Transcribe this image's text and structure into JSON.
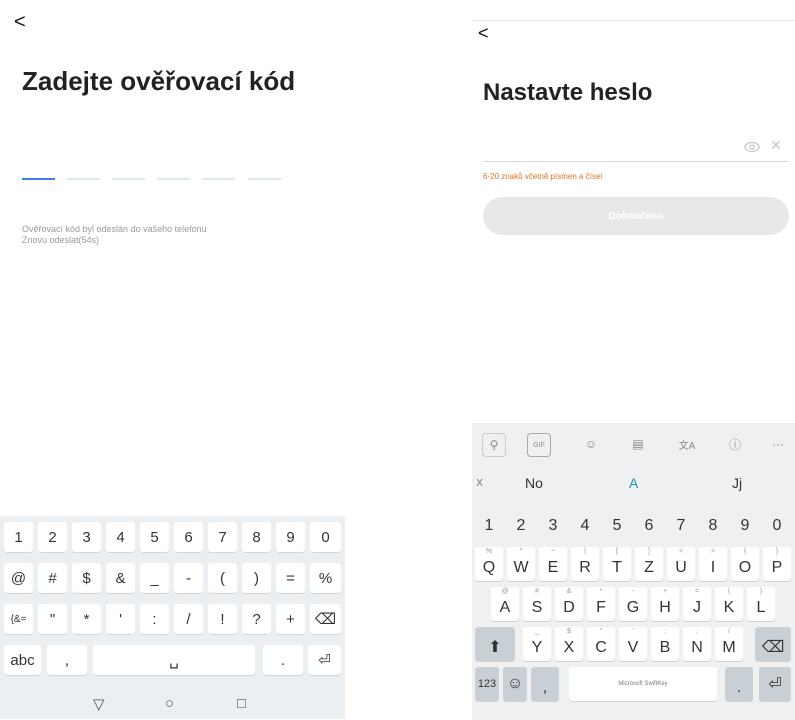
{
  "left": {
    "back_glyph": "<",
    "title": "Zadejte ověřovací kód",
    "code_slots": 6,
    "hint": "Ověřovací kód byl odeslán do vašeho telefonu",
    "resend": "Znovu odeslat(54s)",
    "keyboard": {
      "row1": [
        "1",
        "2",
        "3",
        "4",
        "5",
        "6",
        "7",
        "8",
        "9",
        "0"
      ],
      "row2": [
        "@",
        "#",
        "$",
        "&",
        "_",
        "-",
        "(",
        ")",
        "=",
        "%"
      ],
      "row3": [
        "{&=",
        "\"",
        "*",
        "'",
        ":",
        "/",
        "!",
        "?",
        "+",
        "⌫"
      ],
      "row4": {
        "abc": "abc",
        "comma": ",",
        "space": "␣",
        "dot": ".",
        "enter": "⏎"
      }
    },
    "nav": {
      "back": "▽",
      "home": "○",
      "recent": "□"
    }
  },
  "right": {
    "back_glyph": "<",
    "title": "Nastavte heslo",
    "password_value": "",
    "hint": "6-20 znaků včetně písmen a čísel",
    "done_label": "Dokončeno",
    "toolbar": {
      "search": "🔍",
      "gif": "GIF",
      "sticker": "☺",
      "clipboard": "📋",
      "translate": "文A",
      "info": "ⓘ",
      "more": "···"
    },
    "suggestions": [
      "No",
      "A",
      "Jj"
    ],
    "collapse_glyph": "⌄",
    "keyboard": {
      "numbers": [
        "1",
        "2",
        "3",
        "4",
        "5",
        "6",
        "7",
        "8",
        "9",
        "0"
      ],
      "row1": [
        {
          "k": "Q",
          "h": "%"
        },
        {
          "k": "W",
          "h": "^"
        },
        {
          "k": "E",
          "h": "~"
        },
        {
          "k": "R",
          "h": "|"
        },
        {
          "k": "T",
          "h": "["
        },
        {
          "k": "Z",
          "h": "]"
        },
        {
          "k": "U",
          "h": "<"
        },
        {
          "k": "I",
          "h": ">"
        },
        {
          "k": "O",
          "h": "{"
        },
        {
          "k": "P",
          "h": "}"
        }
      ],
      "row2": [
        {
          "k": "A",
          "h": "@"
        },
        {
          "k": "S",
          "h": "#"
        },
        {
          "k": "D",
          "h": "&"
        },
        {
          "k": "F",
          "h": "*"
        },
        {
          "k": "G",
          "h": "-"
        },
        {
          "k": "H",
          "h": "+"
        },
        {
          "k": "J",
          "h": "="
        },
        {
          "k": "K",
          "h": "("
        },
        {
          "k": "L",
          "h": ")"
        }
      ],
      "row3": [
        {
          "k": "Y",
          "h": "_"
        },
        {
          "k": "X",
          "h": "$"
        },
        {
          "k": "C",
          "h": "\""
        },
        {
          "k": "V",
          "h": "'"
        },
        {
          "k": "B",
          "h": ":"
        },
        {
          "k": "N",
          "h": ";"
        },
        {
          "k": "M",
          "h": "/"
        }
      ],
      "shift": "⬆",
      "backspace": "⌫",
      "numkey": "123",
      "emoji": "☺",
      "mic_comma": ",",
      "space_label": "Microsoft SwiftKey",
      "period": ".",
      "enter": "⏎"
    }
  }
}
